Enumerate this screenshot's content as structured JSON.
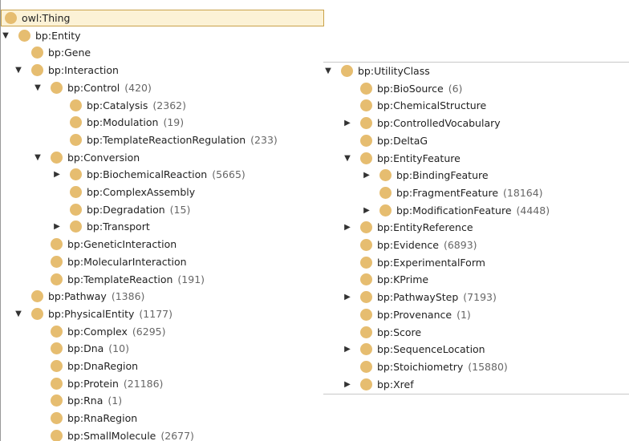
{
  "left_tree": [
    {
      "label": "owl:Thing",
      "count": "",
      "toggle": "",
      "depth": 0,
      "selected": true
    },
    {
      "label": "bp:Entity",
      "count": "",
      "toggle": "expanded",
      "depth": 0
    },
    {
      "label": "bp:Gene",
      "count": "",
      "toggle": "",
      "depth": 1
    },
    {
      "label": "bp:Interaction",
      "count": "",
      "toggle": "expanded",
      "depth": 1
    },
    {
      "label": "bp:Control",
      "count": "(420)",
      "toggle": "expanded",
      "depth": 2
    },
    {
      "label": "bp:Catalysis",
      "count": "(2362)",
      "toggle": "",
      "depth": 3
    },
    {
      "label": "bp:Modulation",
      "count": "(19)",
      "toggle": "",
      "depth": 3
    },
    {
      "label": "bp:TemplateReactionRegulation",
      "count": "(233)",
      "toggle": "",
      "depth": 3
    },
    {
      "label": "bp:Conversion",
      "count": "",
      "toggle": "expanded",
      "depth": 2
    },
    {
      "label": "bp:BiochemicalReaction",
      "count": "(5665)",
      "toggle": "collapsed",
      "depth": 3
    },
    {
      "label": "bp:ComplexAssembly",
      "count": "",
      "toggle": "",
      "depth": 3
    },
    {
      "label": "bp:Degradation",
      "count": "(15)",
      "toggle": "",
      "depth": 3
    },
    {
      "label": "bp:Transport",
      "count": "",
      "toggle": "collapsed",
      "depth": 3
    },
    {
      "label": "bp:GeneticInteraction",
      "count": "",
      "toggle": "",
      "depth": 2
    },
    {
      "label": "bp:MolecularInteraction",
      "count": "",
      "toggle": "",
      "depth": 2
    },
    {
      "label": "bp:TemplateReaction",
      "count": "(191)",
      "toggle": "",
      "depth": 2
    },
    {
      "label": "bp:Pathway",
      "count": "(1386)",
      "toggle": "",
      "depth": 1
    },
    {
      "label": "bp:PhysicalEntity",
      "count": "(1177)",
      "toggle": "expanded",
      "depth": 1
    },
    {
      "label": "bp:Complex",
      "count": "(6295)",
      "toggle": "",
      "depth": 2
    },
    {
      "label": "bp:Dna",
      "count": "(10)",
      "toggle": "",
      "depth": 2
    },
    {
      "label": "bp:DnaRegion",
      "count": "",
      "toggle": "",
      "depth": 2
    },
    {
      "label": "bp:Protein",
      "count": "(21186)",
      "toggle": "",
      "depth": 2
    },
    {
      "label": "bp:Rna",
      "count": "(1)",
      "toggle": "",
      "depth": 2
    },
    {
      "label": "bp:RnaRegion",
      "count": "",
      "toggle": "",
      "depth": 2
    },
    {
      "label": "bp:SmallMolecule",
      "count": "(2677)",
      "toggle": "",
      "depth": 2
    }
  ],
  "right_tree": [
    {
      "label": "bp:UtilityClass",
      "count": "",
      "toggle": "expanded",
      "depth": 0
    },
    {
      "label": "bp:BioSource",
      "count": "(6)",
      "toggle": "",
      "depth": 1
    },
    {
      "label": "bp:ChemicalStructure",
      "count": "",
      "toggle": "",
      "depth": 1
    },
    {
      "label": "bp:ControlledVocabulary",
      "count": "",
      "toggle": "collapsed",
      "depth": 1
    },
    {
      "label": "bp:DeltaG",
      "count": "",
      "toggle": "",
      "depth": 1
    },
    {
      "label": "bp:EntityFeature",
      "count": "",
      "toggle": "expanded",
      "depth": 1
    },
    {
      "label": "bp:BindingFeature",
      "count": "",
      "toggle": "collapsed",
      "depth": 2
    },
    {
      "label": "bp:FragmentFeature",
      "count": "(18164)",
      "toggle": "",
      "depth": 2
    },
    {
      "label": "bp:ModificationFeature",
      "count": "(4448)",
      "toggle": "collapsed",
      "depth": 2
    },
    {
      "label": "bp:EntityReference",
      "count": "",
      "toggle": "collapsed",
      "depth": 1
    },
    {
      "label": "bp:Evidence",
      "count": "(6893)",
      "toggle": "",
      "depth": 1
    },
    {
      "label": "bp:ExperimentalForm",
      "count": "",
      "toggle": "",
      "depth": 1
    },
    {
      "label": "bp:KPrime",
      "count": "",
      "toggle": "",
      "depth": 1
    },
    {
      "label": "bp:PathwayStep",
      "count": "(7193)",
      "toggle": "collapsed",
      "depth": 1
    },
    {
      "label": "bp:Provenance",
      "count": "(1)",
      "toggle": "",
      "depth": 1
    },
    {
      "label": "bp:Score",
      "count": "",
      "toggle": "",
      "depth": 1
    },
    {
      "label": "bp:SequenceLocation",
      "count": "",
      "toggle": "collapsed",
      "depth": 1
    },
    {
      "label": "bp:Stoichiometry",
      "count": "(15880)",
      "toggle": "",
      "depth": 1
    },
    {
      "label": "bp:Xref",
      "count": "",
      "toggle": "collapsed",
      "depth": 1
    }
  ],
  "icons": {
    "expanded": "▼",
    "collapsed": "▶",
    "class_bullet_color": "#e6bd70"
  }
}
